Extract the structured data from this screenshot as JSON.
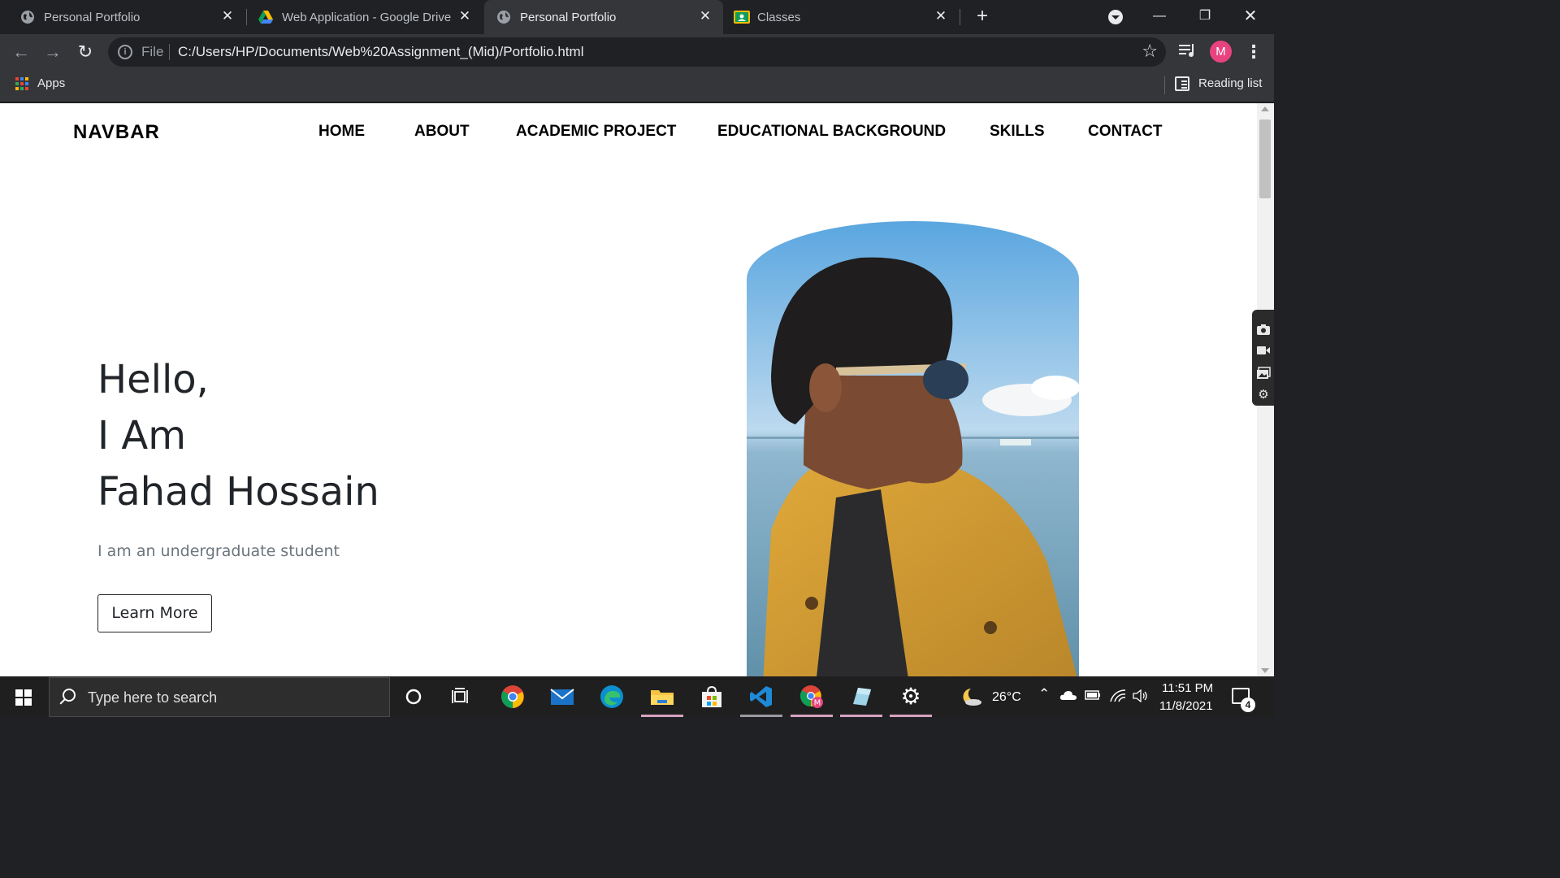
{
  "browser": {
    "tabs": [
      {
        "title": "Personal Portfolio",
        "active": false,
        "favicon": "globe-icon"
      },
      {
        "title": "Web Application - Google Drive",
        "active": false,
        "favicon": "google-drive-icon"
      },
      {
        "title": "Personal Portfolio",
        "active": true,
        "favicon": "globe-icon"
      },
      {
        "title": "Classes",
        "active": false,
        "favicon": "google-classroom-icon"
      }
    ],
    "new_tab": "+",
    "close_glyph": "✕",
    "omnibox": {
      "scheme_label": "File",
      "url": "C:/Users/HP/Documents/Web%20Assignment_(Mid)/Portfolio.html"
    },
    "profile_initial": "M",
    "bookmarks": {
      "apps_label": "Apps",
      "reading_list_label": "Reading list"
    }
  },
  "page": {
    "brand": "NAVBAR",
    "nav": [
      "HOME",
      "ABOUT",
      "ACADEMIC PROJECT",
      "EDUCATIONAL BACKGROUND",
      "SKILLS",
      "CONTACT"
    ],
    "hero": {
      "greeting": "Hello,",
      "intro": "I Am",
      "name": "Fahad Hossain",
      "subtitle": "I am an undergraduate student",
      "button_label": "Learn More"
    }
  },
  "taskbar": {
    "search_placeholder": "Type here to search",
    "weather": "26°C",
    "time": "11:51 PM",
    "date": "11/8/2021",
    "notification_count": "4"
  },
  "colors": {
    "chrome_dark": "#202124",
    "chrome_toolbar": "#35363a",
    "page_bg": "#ffffff",
    "text_dark": "#212529",
    "text_muted": "#6c757d",
    "taskbar": "#1f1f1f",
    "profile": "#e8437f"
  }
}
